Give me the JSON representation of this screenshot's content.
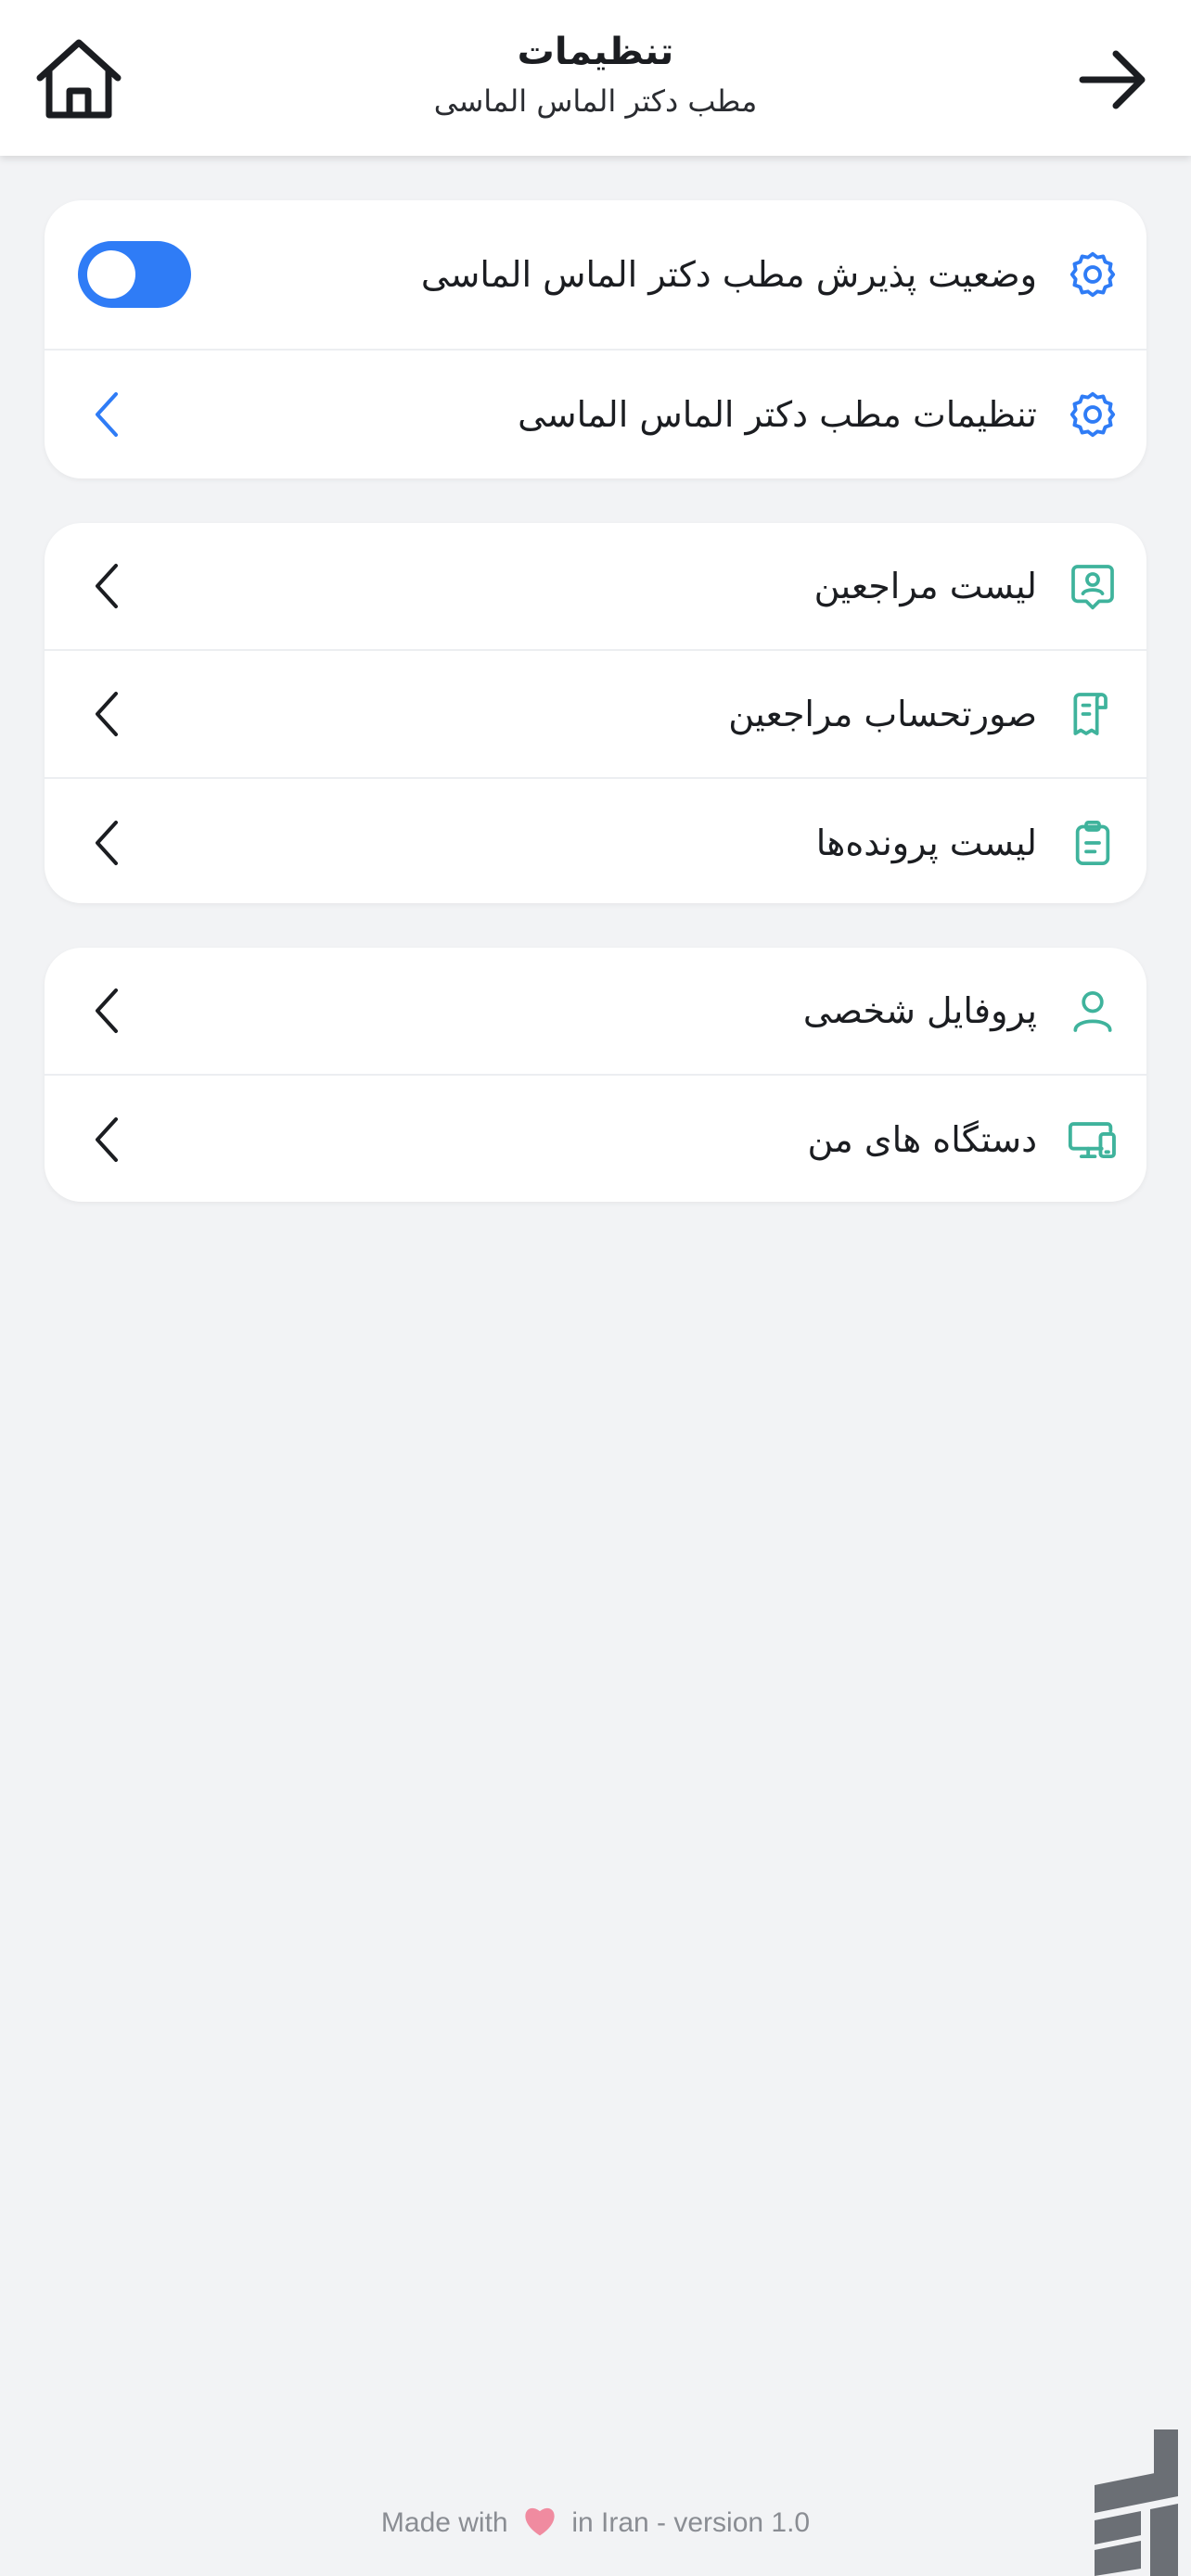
{
  "header": {
    "title": "تنظیمات",
    "subtitle": "مطب دکتر الماس الماسی"
  },
  "sections": [
    {
      "rows": [
        {
          "label": "وضعیت پذیرش مطب دکتر الماس الماسی",
          "icon": "gear-icon",
          "control": "toggle",
          "toggle_on": true
        },
        {
          "label": "تنظیمات مطب دکتر الماس الماسی",
          "icon": "gear-icon",
          "control": "chevron"
        }
      ]
    },
    {
      "rows": [
        {
          "label": "لیست مراجعین",
          "icon": "patient-badge-icon",
          "control": "chevron"
        },
        {
          "label": "صورتحساب مراجعین",
          "icon": "receipt-icon",
          "control": "chevron"
        },
        {
          "label": "لیست پرونده‌ها",
          "icon": "clipboard-icon",
          "control": "chevron"
        }
      ]
    },
    {
      "rows": [
        {
          "label": "پروفایل شخصی",
          "icon": "user-icon",
          "control": "chevron"
        },
        {
          "label": "دستگاه های من",
          "icon": "devices-icon",
          "control": "chevron"
        }
      ]
    }
  ],
  "footer": {
    "prefix": "Made with",
    "suffix": "in Iran - version 1.0"
  },
  "colors": {
    "accent_blue": "#2f7cf6",
    "teal_icon": "#3fb39c",
    "heart": "#f08ba0"
  }
}
